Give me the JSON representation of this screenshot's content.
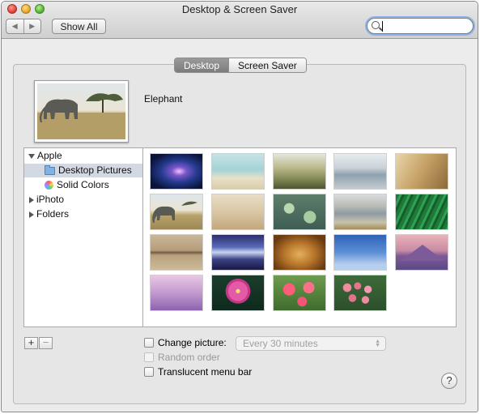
{
  "window": {
    "title": "Desktop & Screen Saver"
  },
  "toolbar": {
    "back_icon": "chevron-left-icon",
    "forward_icon": "chevron-right-icon",
    "show_all_label": "Show All",
    "search_value": ""
  },
  "tabs": [
    {
      "label": "Desktop",
      "selected": true
    },
    {
      "label": "Screen Saver",
      "selected": false
    }
  ],
  "preview": {
    "name": "Elephant"
  },
  "sidebar": {
    "items": [
      {
        "label": "Apple",
        "expanded": true
      },
      {
        "label": "Desktop Pictures",
        "selected": true,
        "icon": "folder-icon"
      },
      {
        "label": "Solid Colors",
        "icon": "color-wheel-icon"
      },
      {
        "label": "iPhoto",
        "expanded": false
      },
      {
        "label": "Folders",
        "expanded": false
      }
    ]
  },
  "wallpapers": [
    "galaxy",
    "beach",
    "grass-field",
    "misty-lake",
    "sand-dune",
    "elephant",
    "zebras",
    "lily-pads",
    "cloudy-lake",
    "green-blades",
    "island-reflection",
    "aurora-mountains",
    "lion",
    "blue-sky",
    "mountain-dusk",
    "pink-mist",
    "lotus",
    "poppies",
    "pink-berries"
  ],
  "bottom": {
    "add_label": "+",
    "remove_label": "−",
    "change_picture_label": "Change picture:",
    "change_picture_checked": false,
    "interval_value": "Every 30 minutes",
    "random_order_label": "Random order",
    "translucent_label": "Translucent menu bar",
    "translucent_checked": false,
    "help_label": "?"
  },
  "colors": {
    "selection": "#d3d9e3",
    "tab_active": "#8a8a8a"
  }
}
